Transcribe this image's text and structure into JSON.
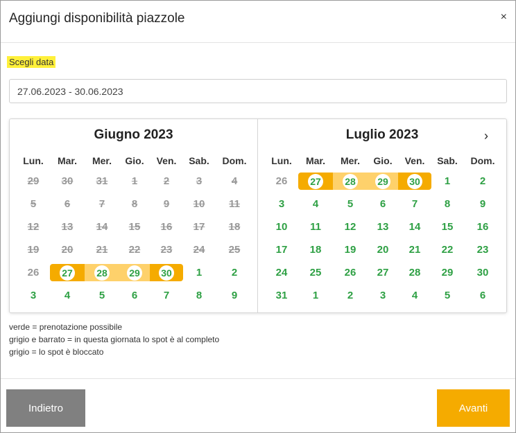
{
  "modal": {
    "title": "Aggiungi disponibilità piazzole",
    "close_icon": "×"
  },
  "form": {
    "label": "Scegli data",
    "date_value": "27.06.2023 - 30.06.2023"
  },
  "calendar": {
    "weekdays": [
      "Lun.",
      "Mar.",
      "Mer.",
      "Gio.",
      "Ven.",
      "Sab.",
      "Dom."
    ],
    "next_icon": "›",
    "months": [
      {
        "title": "Giugno 2023",
        "weeks": [
          [
            {
              "d": "29",
              "s": "struck"
            },
            {
              "d": "30",
              "s": "struck"
            },
            {
              "d": "31",
              "s": "struck"
            },
            {
              "d": "1",
              "s": "struck"
            },
            {
              "d": "2",
              "s": "struck"
            },
            {
              "d": "3",
              "s": "struck"
            },
            {
              "d": "4",
              "s": "struck"
            }
          ],
          [
            {
              "d": "5",
              "s": "struck"
            },
            {
              "d": "6",
              "s": "struck"
            },
            {
              "d": "7",
              "s": "struck"
            },
            {
              "d": "8",
              "s": "struck"
            },
            {
              "d": "9",
              "s": "struck"
            },
            {
              "d": "10",
              "s": "struck"
            },
            {
              "d": "11",
              "s": "struck"
            }
          ],
          [
            {
              "d": "12",
              "s": "struck"
            },
            {
              "d": "13",
              "s": "struck"
            },
            {
              "d": "14",
              "s": "struck"
            },
            {
              "d": "15",
              "s": "struck"
            },
            {
              "d": "16",
              "s": "struck"
            },
            {
              "d": "17",
              "s": "struck"
            },
            {
              "d": "18",
              "s": "struck"
            }
          ],
          [
            {
              "d": "19",
              "s": "struck"
            },
            {
              "d": "20",
              "s": "struck"
            },
            {
              "d": "21",
              "s": "struck"
            },
            {
              "d": "22",
              "s": "struck"
            },
            {
              "d": "23",
              "s": "struck"
            },
            {
              "d": "24",
              "s": "struck"
            },
            {
              "d": "25",
              "s": "struck"
            }
          ],
          [
            {
              "d": "26",
              "s": "grey"
            },
            {
              "d": "27",
              "s": "sel-start"
            },
            {
              "d": "28",
              "s": "sel-mid"
            },
            {
              "d": "29",
              "s": "sel-mid"
            },
            {
              "d": "30",
              "s": "sel-end"
            },
            {
              "d": "1",
              "s": "green"
            },
            {
              "d": "2",
              "s": "green"
            }
          ],
          [
            {
              "d": "3",
              "s": "green"
            },
            {
              "d": "4",
              "s": "green"
            },
            {
              "d": "5",
              "s": "green"
            },
            {
              "d": "6",
              "s": "green"
            },
            {
              "d": "7",
              "s": "green"
            },
            {
              "d": "8",
              "s": "green"
            },
            {
              "d": "9",
              "s": "green"
            }
          ]
        ]
      },
      {
        "title": "Luglio 2023",
        "weeks": [
          [
            {
              "d": "26",
              "s": "grey"
            },
            {
              "d": "27",
              "s": "sel-start"
            },
            {
              "d": "28",
              "s": "sel-mid"
            },
            {
              "d": "29",
              "s": "sel-mid"
            },
            {
              "d": "30",
              "s": "sel-end"
            },
            {
              "d": "1",
              "s": "green"
            },
            {
              "d": "2",
              "s": "green"
            }
          ],
          [
            {
              "d": "3",
              "s": "green"
            },
            {
              "d": "4",
              "s": "green"
            },
            {
              "d": "5",
              "s": "green"
            },
            {
              "d": "6",
              "s": "green"
            },
            {
              "d": "7",
              "s": "green"
            },
            {
              "d": "8",
              "s": "green"
            },
            {
              "d": "9",
              "s": "green"
            }
          ],
          [
            {
              "d": "10",
              "s": "green"
            },
            {
              "d": "11",
              "s": "green"
            },
            {
              "d": "12",
              "s": "green"
            },
            {
              "d": "13",
              "s": "green"
            },
            {
              "d": "14",
              "s": "green"
            },
            {
              "d": "15",
              "s": "green"
            },
            {
              "d": "16",
              "s": "green"
            }
          ],
          [
            {
              "d": "17",
              "s": "green"
            },
            {
              "d": "18",
              "s": "green"
            },
            {
              "d": "19",
              "s": "green"
            },
            {
              "d": "20",
              "s": "green"
            },
            {
              "d": "21",
              "s": "green"
            },
            {
              "d": "22",
              "s": "green"
            },
            {
              "d": "23",
              "s": "green"
            }
          ],
          [
            {
              "d": "24",
              "s": "green"
            },
            {
              "d": "25",
              "s": "green"
            },
            {
              "d": "26",
              "s": "green"
            },
            {
              "d": "27",
              "s": "green"
            },
            {
              "d": "28",
              "s": "green"
            },
            {
              "d": "29",
              "s": "green"
            },
            {
              "d": "30",
              "s": "green"
            }
          ],
          [
            {
              "d": "31",
              "s": "green"
            },
            {
              "d": "1",
              "s": "green"
            },
            {
              "d": "2",
              "s": "green"
            },
            {
              "d": "3",
              "s": "green"
            },
            {
              "d": "4",
              "s": "green"
            },
            {
              "d": "5",
              "s": "green"
            },
            {
              "d": "6",
              "s": "green"
            }
          ]
        ]
      }
    ]
  },
  "legend": {
    "line1": "verde = prenotazione possibile",
    "line2": "grigio e barrato = in questa giornata lo spot è al completo",
    "line3": "grigio = lo spot è bloccato"
  },
  "footer": {
    "back_label": "Indietro",
    "next_label": "Avanti"
  },
  "colors": {
    "accent": "#f5ab00",
    "range": "#fed16b",
    "available": "#2ea044",
    "unavailable": "#999999",
    "label_highlight": "#fff03a",
    "back_button": "#808080"
  }
}
